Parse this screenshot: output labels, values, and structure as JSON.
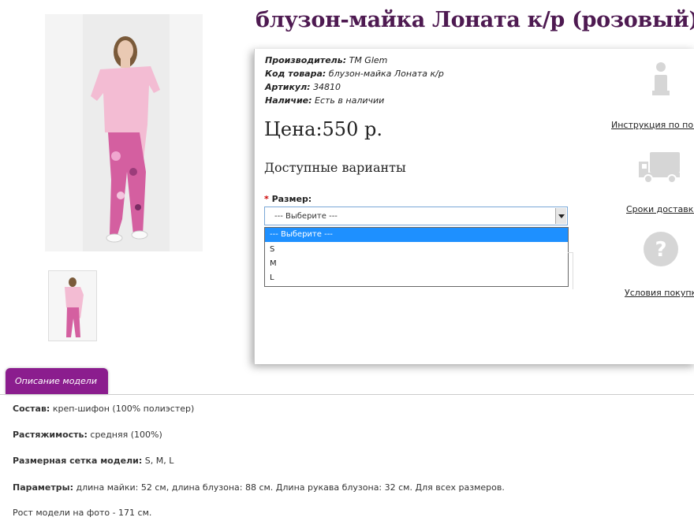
{
  "product": {
    "title": "блузон-майка Лоната к/р (розовый)",
    "manufacturer_label": "Производитель:",
    "manufacturer": "TM Glem",
    "code_label": "Код товара:",
    "code": "блузон-майка Лоната к/р",
    "sku_label": "Артикул:",
    "sku": "34810",
    "stock_label": "Наличие:",
    "stock": "Есть в наличии",
    "price": "Цена:550 р.",
    "variants_heading": "Доступные варианты",
    "size_label": "Размер:",
    "size_required_mark": "*",
    "size_selected": "--- Выберите ---",
    "size_options": [
      "--- Выберите ---",
      "S",
      "M",
      "L"
    ]
  },
  "side_links": {
    "instruction": "Инструкция по покупке",
    "delivery": "Сроки доставки",
    "terms": "Условия покупки"
  },
  "icons": {
    "info": "info-icon",
    "truck": "truck-icon",
    "question": "question-icon"
  },
  "tab": {
    "label": "Описание модели"
  },
  "description": {
    "composition_label": "Состав:",
    "composition": "креп-шифон (100% полиэстер)",
    "stretch_label": "Растяжимость:",
    "stretch": "средняя (100%)",
    "sizes_label": "Размерная сетка модели:",
    "sizes": "S, M, L",
    "params_label": "Параметры:",
    "params": "длина майки: 52 см, длина блузона: 88 см. Длина рукава блузона: 32 см. Для всех размеров.",
    "model_height": "Рост модели на фото - 171 см."
  },
  "colors": {
    "title": "#4e1a51",
    "tab": "#8b1d8e",
    "selected_option": "#1e90ff"
  }
}
